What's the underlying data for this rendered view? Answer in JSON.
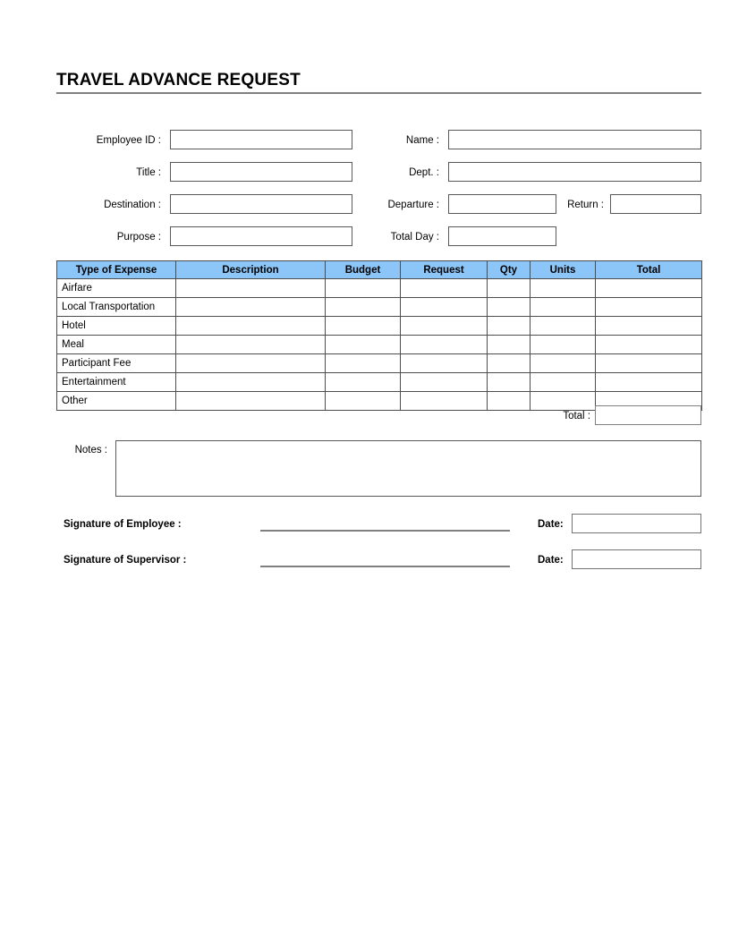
{
  "document": {
    "title": "TRAVEL ADVANCE REQUEST"
  },
  "form": {
    "left_fields": [
      {
        "label": "Employee ID :",
        "value": "",
        "placeholder": ""
      },
      {
        "label": "Title :",
        "value": "",
        "placeholder": ""
      },
      {
        "label": "Destination :",
        "value": "",
        "placeholder": ""
      },
      {
        "label": "Purpose :",
        "value": "",
        "placeholder": ""
      }
    ],
    "right_fields": [
      {
        "label": "Name :",
        "value": "",
        "placeholder": ""
      },
      {
        "label": "Dept. :",
        "value": "",
        "placeholder": ""
      },
      {
        "label": "Departure :",
        "value": "",
        "placeholder": ""
      },
      {
        "label": "Return :",
        "value": "",
        "placeholder": ""
      },
      {
        "label": "Total Day :",
        "value": "",
        "placeholder": ""
      }
    ]
  },
  "expense_table": {
    "headers": [
      "Type of Expense",
      "Description",
      "Budget",
      "Request",
      "Qty",
      "Units",
      "Total"
    ],
    "rows": [
      {
        "type": "Airfare",
        "description": "",
        "budget": "",
        "request": "",
        "qty": "",
        "units": "",
        "total": ""
      },
      {
        "type": "Local Transportation",
        "description": "",
        "budget": "",
        "request": "",
        "qty": "",
        "units": "",
        "total": ""
      },
      {
        "type": "Hotel",
        "description": "",
        "budget": "",
        "request": "",
        "qty": "",
        "units": "",
        "total": ""
      },
      {
        "type": "Meal",
        "description": "",
        "budget": "",
        "request": "",
        "qty": "",
        "units": "",
        "total": ""
      },
      {
        "type": "Participant Fee",
        "description": "",
        "budget": "",
        "request": "",
        "qty": "",
        "units": "",
        "total": ""
      },
      {
        "type": "Entertainment",
        "description": "",
        "budget": "",
        "request": "",
        "qty": "",
        "units": "",
        "total": ""
      },
      {
        "type": "Other",
        "description": "",
        "budget": "",
        "request": "",
        "qty": "",
        "units": "",
        "total": ""
      }
    ],
    "total_label": "Total :",
    "total_value": "",
    "header_color": "#8CC5F7"
  },
  "notes": {
    "label": "Notes :",
    "value": "",
    "placeholder": ""
  },
  "signatures": {
    "employee": {
      "label": "Signature of Employee :",
      "date_label": "Date:",
      "date_value": ""
    },
    "supervisor": {
      "label": "Signature of Supervisor :",
      "date_label": "Date:",
      "date_value": ""
    }
  }
}
